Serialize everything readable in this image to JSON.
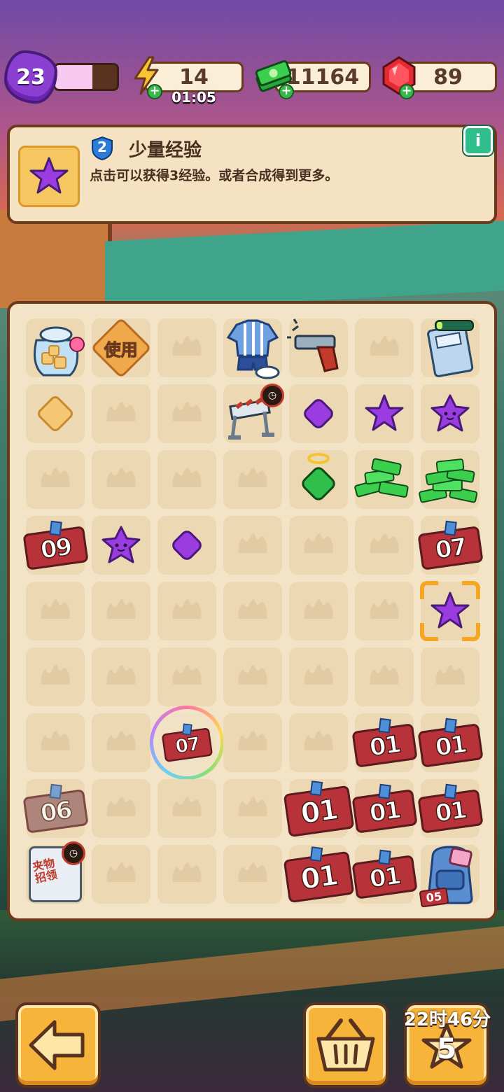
{
  "hud": {
    "level": "23",
    "xp_fraction": 0.6,
    "energy": {
      "value": "14",
      "timer": "01:05",
      "icon": "lightning-icon"
    },
    "cash": {
      "value": "11164",
      "icon": "cash-stack-icon"
    },
    "gems": {
      "value": "89",
      "icon": "ruby-icon"
    }
  },
  "info_panel": {
    "level": "2",
    "title": "少量经验",
    "description": "点击可以获得3经验。或者合成得到更多。",
    "info_button": "i"
  },
  "board": {
    "use_label": "使用",
    "tickets": {
      "t09": "09",
      "t07a": "07",
      "t07b": "07",
      "t01a": "01",
      "t01b": "01",
      "t01c": "01",
      "t01d": "01",
      "t01e": "01",
      "t01f": "01",
      "t01g": "01",
      "t06": "06",
      "t05": "05"
    },
    "claw_box_text": "夹物招领"
  },
  "footer": {
    "timer_label": "22时46分",
    "star_count": "5"
  },
  "colors": {
    "board_bg": "#f3e4c8",
    "tile_bg": "#ecd8b3",
    "border": "#6b3a1c",
    "star_purple": "#9a3ce0",
    "button_orange": "#f6b53a"
  }
}
